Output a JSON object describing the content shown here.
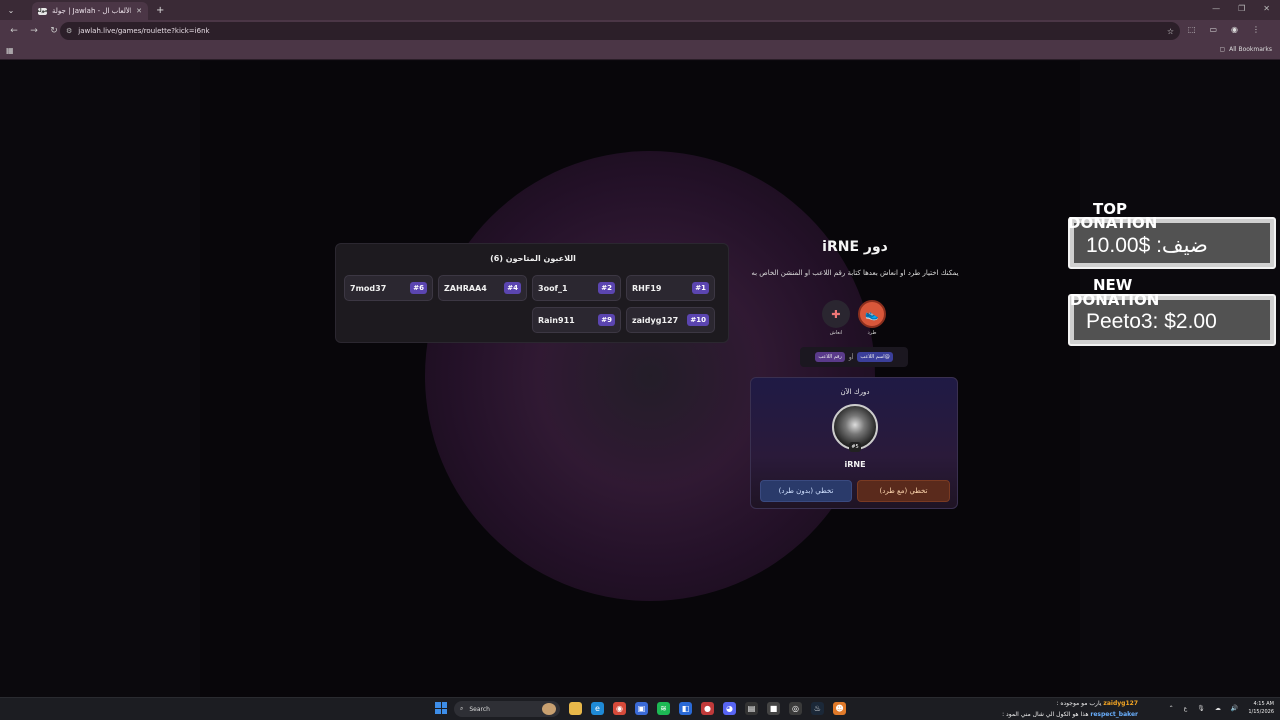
{
  "browser": {
    "tab_title": "جولة | Jawlah - منصة الألعاب ال...",
    "tab_favicon_text": "جولة",
    "url": "jawlah.live/games/roulette?kick=i6nk",
    "all_bookmarks": "All Bookmarks"
  },
  "players": {
    "title": "اللاعبون المتاحون (6)",
    "list": [
      {
        "name": "RHF19",
        "num": "#1"
      },
      {
        "name": "3oof_1",
        "num": "#2"
      },
      {
        "name": "ZAHRAA4",
        "num": "#4"
      },
      {
        "name": "7mod37",
        "num": "#6"
      },
      {
        "name": "zaidyg127",
        "num": "#10"
      },
      {
        "name": "Rain911",
        "num": "#9"
      }
    ]
  },
  "turn": {
    "title": "دور iRNE",
    "description": "يمكنك اختيار طرد او انعاش بعدها كتابة رقم اللاعب او المنشن الخاص به",
    "kick_label": "طرد",
    "revive_label": "انعاش",
    "hint_name": "@اسم اللاعب",
    "hint_or": "أو",
    "hint_num": "رقم اللاعب",
    "card_label": "دورك الآن",
    "player_name": "iRNE",
    "player_badge": "#5",
    "skip_with_kick": "تخطي (مع طرد)",
    "skip_no_kick": "تخطي (بدون طرد)"
  },
  "donations": {
    "top_tag_1": "TOP",
    "top_tag_2": "DONATION",
    "top_value": "ضيف: $10.00",
    "new_tag_1": "NEW",
    "new_tag_2": "DONATION",
    "new_value": "Peeto3: $2.00"
  },
  "taskbar": {
    "search": "Search",
    "chat_line_1_user": "zaidyg127",
    "chat_line_1_msg": "يارب مو موجوده :",
    "chat_line_2_user": "respect_baker",
    "chat_line_2_msg": "هذا هو الكول الي شال مني المود :",
    "lang": "ع",
    "time": "4:15 AM",
    "date": "1/15/2026"
  },
  "colors": {
    "accent_purple": "#5b45b0",
    "kick_orange": "#d8573a"
  }
}
